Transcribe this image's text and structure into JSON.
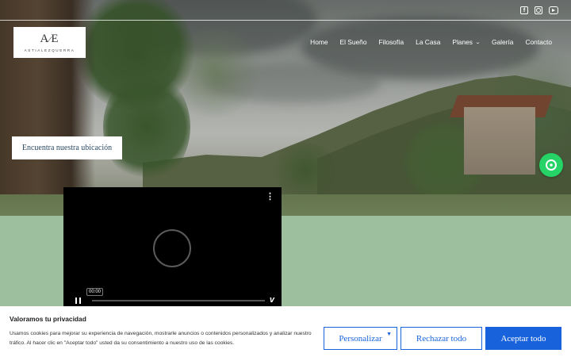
{
  "header": {
    "social": [
      {
        "name": "facebook",
        "icon": "facebook-icon"
      },
      {
        "name": "instagram",
        "icon": "instagram-icon"
      },
      {
        "name": "youtube",
        "icon": "youtube-icon"
      }
    ],
    "logo": {
      "monogram_left": "A",
      "monogram_right": "E",
      "brand": "ASTIALEZQUERRA"
    },
    "nav": [
      {
        "label": "Home"
      },
      {
        "label": "El Sueño"
      },
      {
        "label": "Filosofía"
      },
      {
        "label": "La Casa"
      },
      {
        "label": "Planes",
        "has_dropdown": true
      },
      {
        "label": "Galería"
      },
      {
        "label": "Contacto"
      }
    ]
  },
  "hero": {
    "location_button": "Encuentra nuestra ubicación"
  },
  "whatsapp": {
    "icon": "whatsapp-icon",
    "color": "#25d366"
  },
  "video": {
    "time": "00:00",
    "provider_icon": "vimeo-icon",
    "provider_glyph": "v"
  },
  "cookie": {
    "title": "Valoramos tu privacidad",
    "text": "Usamos cookies para mejorar su experiencia de navegación, mostrarle anuncios o contenidos personalizados y analizar nuestro tráfico. Al hacer clic en \"Aceptar todo\" usted da su consentimiento a nuestro uso de las cookies.",
    "customize_label": "Personalizar",
    "reject_label": "Rechazar todo",
    "accept_label": "Aceptar todo",
    "accent": "#1863dc"
  },
  "colors": {
    "page_green": "#9dbf9d",
    "button_text": "#2b4a63"
  }
}
